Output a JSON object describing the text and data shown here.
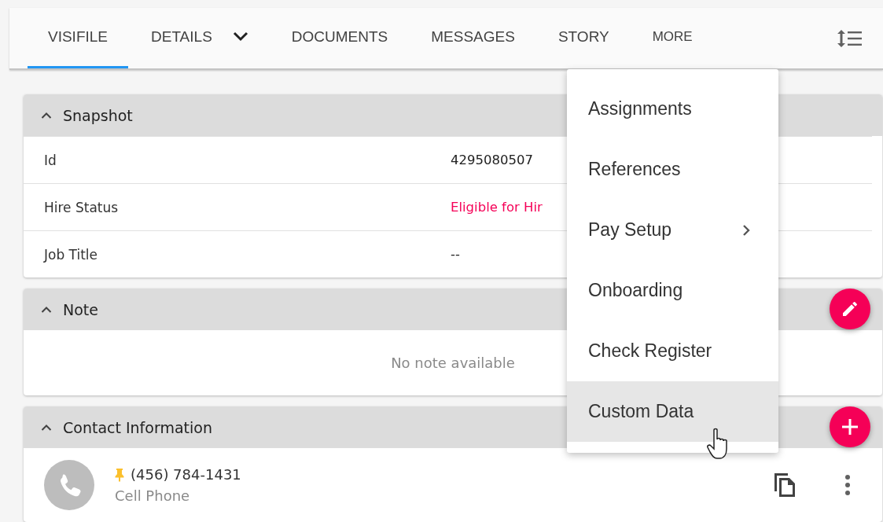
{
  "tabs": [
    {
      "label": "VISIFILE",
      "selected": true,
      "kind": "plain"
    },
    {
      "label": "DETAILS",
      "selected": false,
      "kind": "dropdown"
    },
    {
      "label": "DOCUMENTS",
      "selected": false,
      "kind": "plain"
    },
    {
      "label": "MESSAGES",
      "selected": false,
      "kind": "plain"
    },
    {
      "label": "STORY",
      "selected": false,
      "kind": "plain"
    },
    {
      "label": "MORE",
      "selected": false,
      "kind": "more"
    }
  ],
  "more_menu": {
    "items": [
      {
        "label": "Assignments",
        "selected": false,
        "submenu": false
      },
      {
        "label": "References",
        "selected": false,
        "submenu": false
      },
      {
        "label": "Pay Setup",
        "selected": false,
        "submenu": true
      },
      {
        "label": "Onboarding",
        "selected": false,
        "submenu": false
      },
      {
        "label": "Check Register",
        "selected": false,
        "submenu": false
      },
      {
        "label": "Custom Data",
        "selected": true,
        "submenu": false
      }
    ]
  },
  "cards": [
    {
      "title": "Snapshot",
      "expanded": true,
      "kind": "fields",
      "edit_button": false,
      "add_button": false,
      "rows": [
        {
          "label": "Id",
          "value": "4295080507",
          "color": "#212121"
        },
        {
          "label": "Hire Status",
          "value": "Eligible for Hir",
          "color": "#f50057"
        },
        {
          "label": "Job Title",
          "value": "--",
          "color": "#212121"
        }
      ]
    },
    {
      "title": "Note",
      "expanded": true,
      "kind": "empty",
      "edit_button": true,
      "add_button": false,
      "message": "No note available"
    },
    {
      "title": "Contact Information",
      "expanded": true,
      "kind": "contacts",
      "edit_button": false,
      "add_button": true,
      "contacts": [
        {
          "number": "(456) 784-1431",
          "type": "Cell Phone",
          "pinned": true
        }
      ]
    }
  ]
}
